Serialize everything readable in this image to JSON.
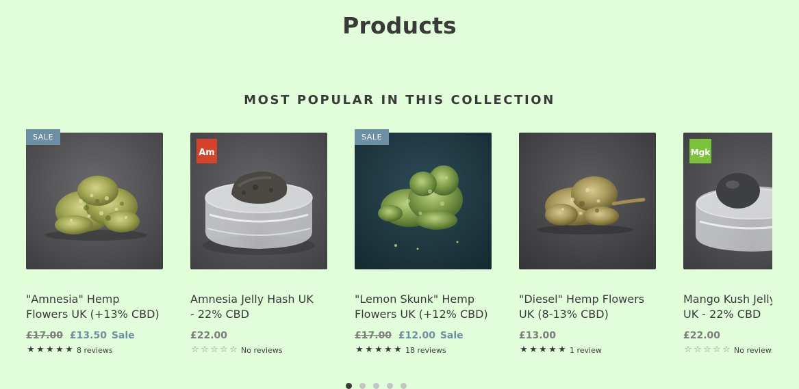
{
  "page": {
    "title": "Products",
    "section_heading": "MOST POPULAR IN THIS COLLECTION"
  },
  "colors": {
    "background": "#e1fdd9",
    "text": "#3a3a3a",
    "sale_accent": "#6c8fa3",
    "muted": "#7d7d7d"
  },
  "products": [
    {
      "badge": "SALE",
      "image_icon": "hemp-flower-bud-icon",
      "title_line1": "\"Amnesia\" Hemp",
      "title_line2": "Flowers UK (+13% CBD)",
      "compare_price": "£17.00",
      "price": "£13.50",
      "sale_label": "Sale",
      "rating": 5,
      "reviews": "8 reviews"
    },
    {
      "badge": "",
      "image_icon": "hash-jar-icon",
      "label_text": "Am",
      "title_line1": "Amnesia Jelly Hash UK",
      "title_line2": "- 22% CBD",
      "compare_price": "",
      "price": "£22.00",
      "sale_label": "",
      "rating": 0,
      "reviews": "No reviews"
    },
    {
      "badge": "SALE",
      "image_icon": "hemp-flower-bud-icon",
      "title_line1": "\"Lemon Skunk\" Hemp",
      "title_line2": "Flowers UK (+12% CBD)",
      "compare_price": "£17.00",
      "price": "£12.00",
      "sale_label": "Sale",
      "rating": 5,
      "reviews": "18 reviews"
    },
    {
      "badge": "",
      "image_icon": "hemp-flower-bud-icon",
      "title_line1": "\"Diesel\" Hemp Flowers",
      "title_line2": "UK (8-13% CBD)",
      "compare_price": "",
      "price": "£13.00",
      "sale_label": "",
      "rating": 5,
      "reviews": "1 review"
    },
    {
      "badge": "",
      "image_icon": "hash-jar-icon",
      "label_text": "Mgk",
      "title_line1": "Mango Kush Jelly Hash",
      "title_line2": "UK - 22% CBD",
      "compare_price": "",
      "price": "£22.00",
      "sale_label": "",
      "rating": 0,
      "reviews": "No reviews"
    }
  ],
  "pagination": {
    "pages": 5,
    "active": 1
  }
}
